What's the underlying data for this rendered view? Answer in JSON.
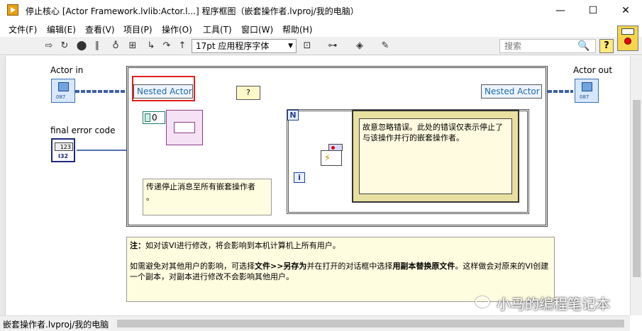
{
  "window": {
    "title": "停止核心 [Actor Framework.lvlib:Actor.l...] 程序框图（嵌套操作者.lvproj/我的电脑）",
    "minimize": "—",
    "maximize": "☐",
    "close": "✕"
  },
  "menu": [
    "文件(F)",
    "编辑(E)",
    "查看(V)",
    "项目(P)",
    "操作(O)",
    "工具(T)",
    "窗口(W)",
    "帮助(H)"
  ],
  "toolbar": {
    "font_select": "17pt 应用程序字体",
    "search_placeholder": "搜索",
    "help": "?",
    "icons": [
      "run-arrow-icon",
      "run-continuous-icon",
      "abort-icon",
      "pause-icon",
      "highlight-execution-icon",
      "retain-wire-values-icon",
      "step-into-icon",
      "step-over-icon",
      "step-out-icon",
      "align-icon",
      "distribute-icon",
      "reorder-icon",
      "cleanup-icon"
    ]
  },
  "diagram": {
    "actor_in_label": "Actor in",
    "actor_out_label": "Actor out",
    "final_error_label": "final error code",
    "nested_actor_in": "Nested Actor",
    "nested_actor_out": "Nested Actor",
    "zero_constant": "0",
    "stop_node": "?",
    "loop_n": "N",
    "loop_i": "i",
    "error_terminal_text": "123",
    "error_terminal_sub": "I32",
    "actor_terminal_sub": "087",
    "film_comment": "故意忽略错误。此处的错误仅表示停止了与该操作并行的嵌套操作者。",
    "send_comment": "传递停止消息至所有嵌套操作者",
    "send_comment_tail": "。",
    "note": {
      "prefix": "注：",
      "line1": "如对该VI进行修改，将会影响到本机计算机上所有用户。",
      "line2a": "如需避免对其他用户的影响，可选择",
      "line2b": "文件>>另存为",
      "line2c": "并在打开的对话框中选择",
      "line2d": "用副本替换原文件",
      "line2e": "。这样做会对原来的VI创建一个副本，对副本进行修改不会影响其他用户。"
    }
  },
  "status_bar": "嵌套操作者.lvproj/我的电脑",
  "watermark": "小马的编程笔记本",
  "colors": {
    "highlight_box": "#e0201e",
    "actor_wire": "#3a5fa8",
    "error_wire": "#1c3fa0",
    "message_wire": "#8e3c8a",
    "film_bg": "#fffbe0"
  }
}
